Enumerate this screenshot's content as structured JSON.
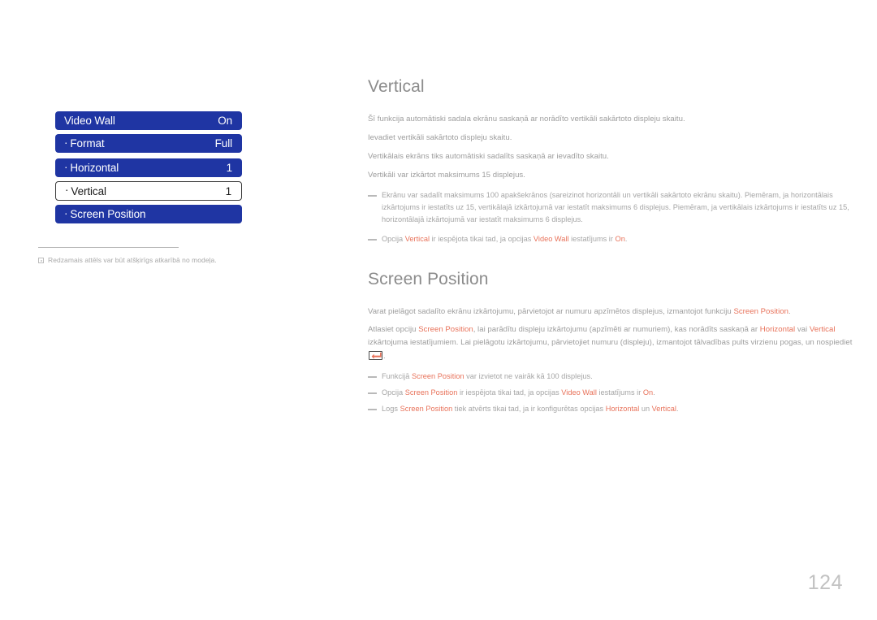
{
  "osd_menu": {
    "bullet": "·",
    "rows": [
      {
        "bullet": "",
        "label": "Video Wall",
        "value": "On",
        "selected": false
      },
      {
        "bullet": "·",
        "label": "Format",
        "value": "Full",
        "selected": false
      },
      {
        "bullet": "·",
        "label": "Horizontal",
        "value": "1",
        "selected": false
      },
      {
        "bullet": "·",
        "label": "Vertical",
        "value": "1",
        "selected": true
      },
      {
        "bullet": "·",
        "label": "Screen Position",
        "value": "",
        "selected": false
      }
    ]
  },
  "figure_note": "Redzamais attēls var būt atšķirīgs atkarībā no modeļa.",
  "sections": [
    {
      "title": "Vertical",
      "lines": [
        "Šī funkcija automātiski sadala ekrānu saskaņā ar norādīto vertikāli sakārtoto displeju skaitu.",
        "Ievadiet vertikāli sakārtoto displeju skaitu.",
        "Vertikālais ekrāns tiks automātiski sadalīts saskaņā ar ievadīto skaitu.",
        "Vertikāli var izkārtot maksimums 15 displejus."
      ],
      "notes": [
        {
          "parts": [
            {
              "t": "Ekrānu var sadalīt maksimums 100 apakšekrānos (sareizinot horizontāli un vertikāli sakārtoto ekrānu skaitu). Piemēram, ja horizontālais izkārtojums ir iestatīts uz 15, vertikālajā izkārtojumā var iestatīt maksimums 6 displejus. Piemēram, ja vertikālais izkārtojums ir iestatīts uz 15, horizontālajā izkārtojumā var iestatīt maksimums 6 displejus.",
              "hl": false
            }
          ]
        },
        {
          "parts": [
            {
              "t": "Opcija ",
              "hl": false
            },
            {
              "t": "Vertical",
              "hl": true
            },
            {
              "t": " ir iespējota tikai tad, ja opcijas ",
              "hl": false
            },
            {
              "t": "Video Wall",
              "hl": true
            },
            {
              "t": " iestatījums ir ",
              "hl": false
            },
            {
              "t": "On",
              "hl": true
            },
            {
              "t": ".",
              "hl": false
            }
          ]
        }
      ]
    },
    {
      "title": "Screen Position",
      "paragraphs": [
        {
          "parts": [
            {
              "t": "Varat pielāgot sadalīto ekrānu izkārtojumu, pārvietojot ar numuru apzīmētos displejus, izmantojot funkciju ",
              "hl": false
            },
            {
              "t": "Screen Position",
              "hl": true
            },
            {
              "t": ".",
              "hl": false
            }
          ]
        },
        {
          "parts": [
            {
              "t": "Atlasiet opciju ",
              "hl": false
            },
            {
              "t": "Screen Position",
              "hl": true
            },
            {
              "t": ", lai parādītu displeju izkārtojumu (apzīmēti ar numuriem), kas norādīts saskaņā ar ",
              "hl": false
            },
            {
              "t": "Horizontal",
              "hl": true
            },
            {
              "t": " vai ",
              "hl": false
            },
            {
              "t": "Vertical",
              "hl": true
            },
            {
              "t": " izkārtojuma iestatījumiem. Lai pielāgotu izkārtojumu, pārvietojiet numuru (displeju), izmantojot tālvadības pults virzienu pogas, un nospiediet ",
              "hl": false
            },
            {
              "t": "[ENTER_KEY]",
              "hl": false
            },
            {
              "t": ".",
              "hl": false
            }
          ]
        }
      ],
      "notes": [
        {
          "parts": [
            {
              "t": "Funkcijā ",
              "hl": false
            },
            {
              "t": "Screen Position",
              "hl": true
            },
            {
              "t": " var izvietot ne vairāk kā 100 displejus.",
              "hl": false
            }
          ]
        },
        {
          "parts": [
            {
              "t": "Opcija ",
              "hl": false
            },
            {
              "t": "Screen Position",
              "hl": true
            },
            {
              "t": " ir iespējota tikai tad, ja opcijas ",
              "hl": false
            },
            {
              "t": "Video Wall",
              "hl": true
            },
            {
              "t": " iestatījums ir ",
              "hl": false
            },
            {
              "t": "On",
              "hl": true
            },
            {
              "t": ".",
              "hl": false
            }
          ]
        },
        {
          "parts": [
            {
              "t": "Logs ",
              "hl": false
            },
            {
              "t": "Screen Position",
              "hl": true
            },
            {
              "t": " tiek atvērts tikai tad, ja ir konfigurētas opcijas ",
              "hl": false
            },
            {
              "t": "Horizontal",
              "hl": true
            },
            {
              "t": " un ",
              "hl": false
            },
            {
              "t": "Vertical",
              "hl": true
            },
            {
              "t": ".",
              "hl": false
            }
          ]
        }
      ]
    }
  ],
  "page_number": "124",
  "colors": {
    "menu_blue": "#1f35a3",
    "highlight": "#e8725a",
    "body_text": "#9d9d9d",
    "page_number": "#c2c2c2"
  }
}
